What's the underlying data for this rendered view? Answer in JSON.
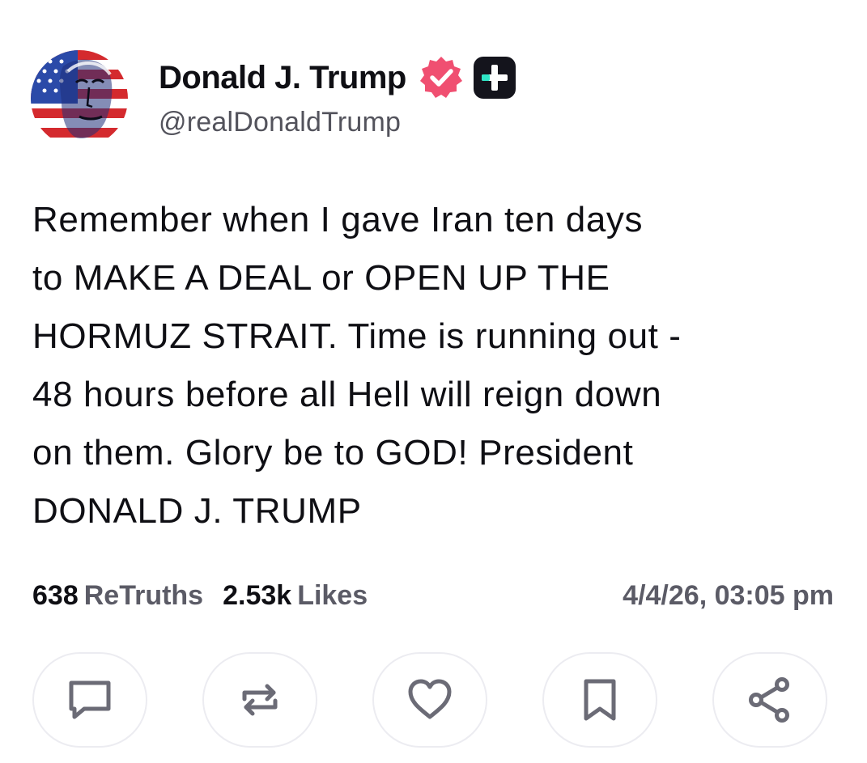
{
  "author": {
    "display_name": "Donald J. Trump",
    "handle": "@realDonaldTrump",
    "avatar_icon": "flag-portrait-avatar",
    "verified_icon": "verified-badge-icon",
    "verified_color": "#f04f71",
    "plus_icon": "truth-plus-badge-icon",
    "plus_accent": "#2ee6c6"
  },
  "post": {
    "text": "Remember when I gave Iran ten days\nto MAKE A DEAL or OPEN UP THE\nHORMUZ STRAIT. Time is running out -\n48 hours before all Hell will reign down\non them. Glory be to GOD! President\nDONALD J. TRUMP"
  },
  "stats": {
    "retruths_count": "638",
    "retruths_label": "ReTruths",
    "likes_count": "2.53k",
    "likes_label": "Likes",
    "timestamp": "4/4/26, 03:05 pm"
  },
  "actions": [
    {
      "icon": "comment-icon"
    },
    {
      "icon": "retruth-icon"
    },
    {
      "icon": "heart-icon"
    },
    {
      "icon": "bookmark-icon"
    },
    {
      "icon": "share-icon"
    }
  ],
  "colors": {
    "icon_stroke": "#6b6b76",
    "button_border": "#ececf1"
  }
}
